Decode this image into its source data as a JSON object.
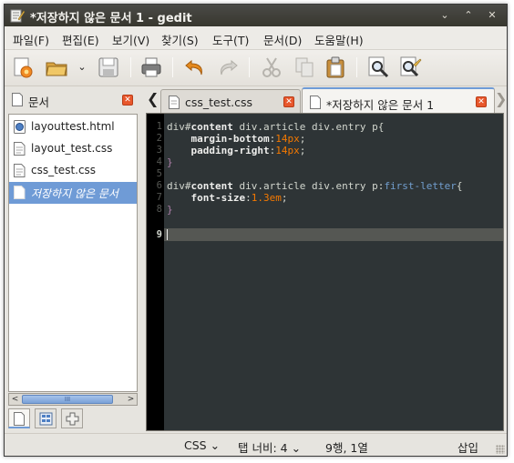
{
  "window": {
    "title": "*저장하지 않은 문서 1 - gedit",
    "minimize_glyph": "⌄",
    "maximize_glyph": "⌃",
    "close_glyph": "✕"
  },
  "menubar": {
    "items": [
      {
        "label": "파일(F)"
      },
      {
        "label": "편집(E)"
      },
      {
        "label": "보기(V)"
      },
      {
        "label": "찾기(S)"
      },
      {
        "label": "도구(T)"
      },
      {
        "label": "문서(D)"
      },
      {
        "label": "도움말(H)"
      }
    ]
  },
  "toolbar": {
    "icons": [
      "new-document-icon",
      "open-icon",
      "open-recent-dropdown-icon",
      "save-icon",
      "print-icon",
      "undo-icon",
      "redo-icon",
      "cut-icon",
      "copy-icon",
      "paste-icon",
      "find-icon",
      "find-replace-icon"
    ]
  },
  "side_panel": {
    "title": "문서",
    "close_glyph": "✕",
    "documents": [
      {
        "name": "layouttest.html",
        "icon": "html-file-icon"
      },
      {
        "name": "layout_test.css",
        "icon": "css-file-icon"
      },
      {
        "name": "css_test.css",
        "icon": "css-file-icon"
      },
      {
        "name": "저장하지 않은 문서",
        "icon": "new-file-icon",
        "selected": true
      }
    ],
    "scroll_left": "<",
    "scroll_right": ">",
    "scroll_thumb": "III"
  },
  "tabs": {
    "prev": "❮",
    "next": "❯",
    "items": [
      {
        "label": "css_test.css",
        "active": false
      },
      {
        "label": "*저장하지 않은 문서 1",
        "active": true
      }
    ],
    "close_glyph": "✕"
  },
  "editor": {
    "current_line": 9,
    "line_numbers": [
      "1",
      "2",
      "3",
      "4",
      "5",
      "6",
      "7",
      "8",
      "9"
    ]
  },
  "statusbar": {
    "language": "CSS",
    "tab_width": "탭 너비: 4",
    "position": "9행, 1열",
    "mode": "삽입"
  },
  "colors": {
    "accent": "#6f9bd6",
    "editor_bg": "#2e3436",
    "number": "#f57900",
    "pseudo": "#729fcf"
  }
}
